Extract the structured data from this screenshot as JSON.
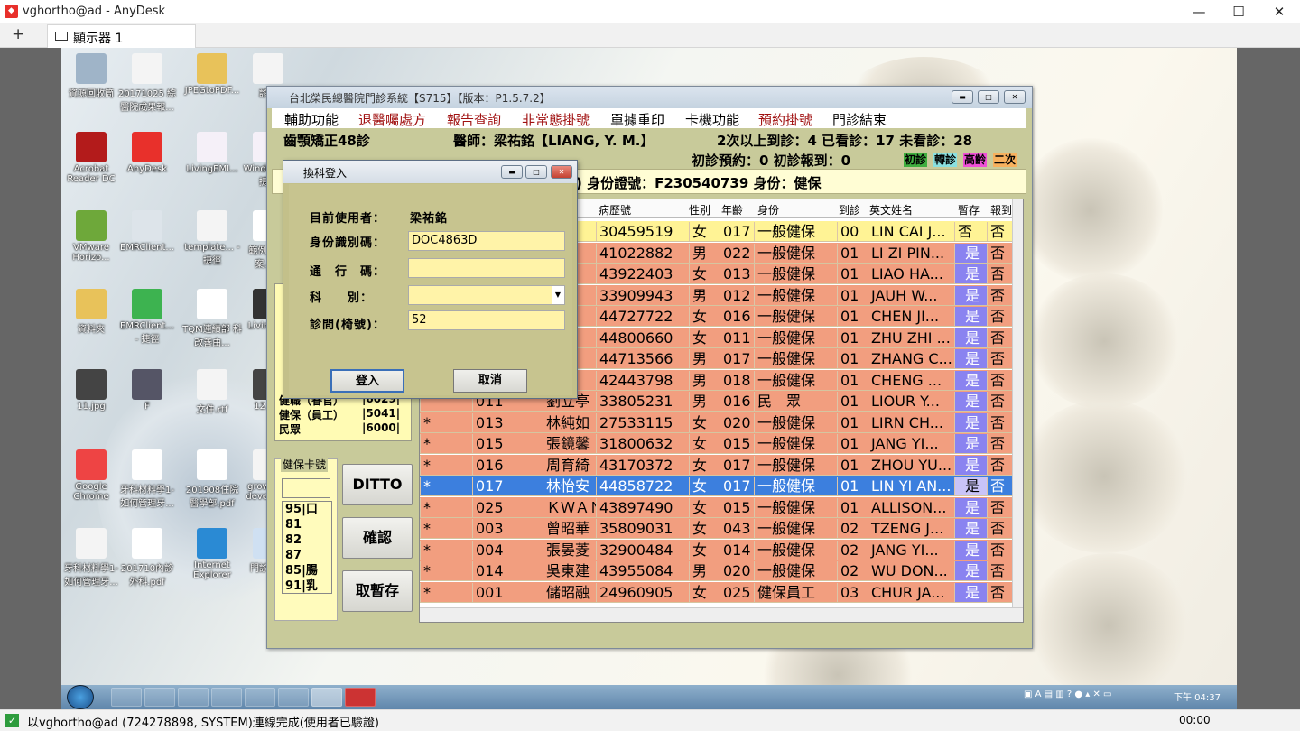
{
  "anydesk": {
    "window_title": "vghortho@ad - AnyDesk",
    "tab_label": "顯示器 1",
    "win_min": "—",
    "win_max": "☐",
    "win_close": "✕",
    "plus": "+",
    "status_text": "以vghortho@ad (724278898, SYSTEM)連線完成(使用者已驗證)",
    "status_time": "00:00"
  },
  "desktop": {
    "icons": [
      {
        "label": "資源回收筒",
        "icon": "recycle-bin-icon"
      },
      {
        "label": "20171025 綜醫院成果報...",
        "icon": "document-icon"
      },
      {
        "label": "JPEGtoPDF...",
        "icon": "folder-icon"
      },
      {
        "label": "診斷",
        "icon": "document-icon"
      },
      {
        "label": "Acrobat Reader DC",
        "icon": "acrobat-icon"
      },
      {
        "label": "AnyDesk",
        "icon": "anydesk-icon"
      },
      {
        "label": "LivingEMI...",
        "icon": "hospital-app-icon"
      },
      {
        "label": "Window... - 捷徑",
        "icon": "hospital-app-icon"
      },
      {
        "label": "VMware Horizo...",
        "icon": "vmware-icon"
      },
      {
        "label": "EMRClient...",
        "icon": "settings-file-icon"
      },
      {
        "label": "template... - 捷徑",
        "icon": "document-icon"
      },
      {
        "label": "範例 品質 案.pdf",
        "icon": "pdf-icon"
      },
      {
        "label": "資料夾",
        "icon": "folder-icon"
      },
      {
        "label": "EMRClient... - 捷徑",
        "icon": "medical-cross-icon"
      },
      {
        "label": "TQM連續部 科改善由...",
        "icon": "pdf-icon"
      },
      {
        "label": "LivingEM",
        "icon": "tooth-icon"
      },
      {
        "label": "11.jpg",
        "icon": "xray-icon"
      },
      {
        "label": "F",
        "icon": "image-app-icon"
      },
      {
        "label": "文件.rtf",
        "icon": "document-icon"
      },
      {
        "label": "12.jpg",
        "icon": "xray-icon"
      },
      {
        "label": "Google Chrome",
        "icon": "chrome-icon"
      },
      {
        "label": "牙科材料學1-如何管理牙...",
        "icon": "pdf-icon"
      },
      {
        "label": "201908住院 醫學部.pdf",
        "icon": "pdf-icon"
      },
      {
        "label": "growth & develop...",
        "icon": "document-icon"
      },
      {
        "label": "牙科材料學1-如何管理牙...",
        "icon": "document-icon"
      },
      {
        "label": "201710內診 外科.pdf",
        "icon": "pdf-icon"
      },
      {
        "label": "Internet Explorer",
        "icon": "ie-icon"
      },
      {
        "label": "門診系統",
        "icon": "window-app-icon"
      }
    ],
    "clock": "下午 04:37"
  },
  "app": {
    "title": "台北榮民總醫院門診系統【S715】【版本：P1.5.7.2】",
    "menu": [
      "輔助功能",
      "退醫囑處方",
      "報告查詢",
      "非常態掛號",
      "單據重印",
      "卡機功能",
      "預約掛號",
      "門診結束"
    ],
    "menu_colors": [
      "#000000",
      "#a01010",
      "#a01010",
      "#a01010",
      "#000000",
      "#000000",
      "#a01010",
      "#000000"
    ],
    "clinic": "齒顎矯正48診",
    "doctor": "醫師：梁祐銘【LIANG, Y. M.】",
    "counts": "2次以上到診：4  已看診：17  未看診：28",
    "reserve": "初診預約：0  初診報到：0",
    "legend": [
      "初診",
      "轉診",
      "高齡",
      "二次"
    ],
    "legend_colors": [
      "#3fae3f",
      "#8ae0e0",
      "#ee4fd6",
      "#f7b15e"
    ],
    "id_line": ")  身份證號：F230540739  身份：健保",
    "grid_headers": [
      "病歷號",
      "性別",
      "年齡",
      "身份",
      "到診",
      "英文姓名",
      "暫存",
      "報到"
    ],
    "rows": [
      {
        "mark": "",
        "no": "",
        "name": "",
        "chart": "30459519",
        "sex": "女",
        "age": "017",
        "id": "一般健保",
        "visit": "00",
        "en": "LIN CAI J...",
        "tmp": "否",
        "chk": "否",
        "style": "hl"
      },
      {
        "mark": "",
        "no": "",
        "name": "",
        "chart": "41022882",
        "sex": "男",
        "age": "022",
        "id": "一般健保",
        "visit": "01",
        "en": "LI ZI PIN...",
        "tmp": "是",
        "chk": "否",
        "style": ""
      },
      {
        "mark": "",
        "no": "",
        "name": "",
        "chart": "43922403",
        "sex": "女",
        "age": "013",
        "id": "一般健保",
        "visit": "01",
        "en": "LIAO HA...",
        "tmp": "是",
        "chk": "否",
        "style": ""
      },
      {
        "mark": "",
        "no": "",
        "name": "",
        "chart": "33909943",
        "sex": "男",
        "age": "012",
        "id": "一般健保",
        "visit": "01",
        "en": "JAUH W...",
        "tmp": "是",
        "chk": "否",
        "style": ""
      },
      {
        "mark": "",
        "no": "",
        "name": "",
        "chart": "44727722",
        "sex": "女",
        "age": "016",
        "id": "一般健保",
        "visit": "01",
        "en": "CHEN JI...",
        "tmp": "是",
        "chk": "否",
        "style": ""
      },
      {
        "mark": "",
        "no": "",
        "name": "",
        "chart": "44800660",
        "sex": "女",
        "age": "011",
        "id": "一般健保",
        "visit": "01",
        "en": "ZHU ZHI ...",
        "tmp": "是",
        "chk": "否",
        "style": ""
      },
      {
        "mark": "",
        "no": "",
        "name": "",
        "chart": "44713566",
        "sex": "男",
        "age": "017",
        "id": "一般健保",
        "visit": "01",
        "en": "ZHANG C...",
        "tmp": "是",
        "chk": "否",
        "style": ""
      },
      {
        "mark": "",
        "no": "",
        "name": "",
        "chart": "42443798",
        "sex": "男",
        "age": "018",
        "id": "一般健保",
        "visit": "01",
        "en": "CHENG ...",
        "tmp": "是",
        "chk": "否",
        "style": ""
      },
      {
        "mark": "",
        "no": "011",
        "name": "劉立亭",
        "chart": "33805231",
        "sex": "男",
        "age": "016",
        "id": "民　眾",
        "visit": "01",
        "en": "LIOUR Y...",
        "tmp": "是",
        "chk": "否",
        "style": ""
      },
      {
        "mark": "*",
        "no": "013",
        "name": "林純如",
        "chart": "27533115",
        "sex": "女",
        "age": "020",
        "id": "一般健保",
        "visit": "01",
        "en": "LIRN CH...",
        "tmp": "是",
        "chk": "否",
        "style": ""
      },
      {
        "mark": "*",
        "no": "015",
        "name": "張鏡馨",
        "chart": "31800632",
        "sex": "女",
        "age": "015",
        "id": "一般健保",
        "visit": "01",
        "en": "JANG YI...",
        "tmp": "是",
        "chk": "否",
        "style": ""
      },
      {
        "mark": "*",
        "no": "016",
        "name": "周育綺",
        "chart": "43170372",
        "sex": "女",
        "age": "017",
        "id": "一般健保",
        "visit": "01",
        "en": "ZHOU YU...",
        "tmp": "是",
        "chk": "否",
        "style": ""
      },
      {
        "mark": "*",
        "no": "017",
        "name": "林怡安",
        "chart": "44858722",
        "sex": "女",
        "age": "017",
        "id": "一般健保",
        "visit": "01",
        "en": "LIN YI AN...",
        "tmp": "是",
        "chk": "否",
        "style": "sel"
      },
      {
        "mark": "*",
        "no": "025",
        "name": "ＫＷＡＮ",
        "chart": "43897490",
        "sex": "女",
        "age": "015",
        "id": "一般健保",
        "visit": "01",
        "en": "ALLISON...",
        "tmp": "是",
        "chk": "否",
        "style": ""
      },
      {
        "mark": "*",
        "no": "003",
        "name": "曾昭華",
        "chart": "35809031",
        "sex": "女",
        "age": "043",
        "id": "一般健保",
        "visit": "02",
        "en": "TZENG J...",
        "tmp": "是",
        "chk": "否",
        "style": ""
      },
      {
        "mark": "*",
        "no": "004",
        "name": "張晏菱",
        "chart": "32900484",
        "sex": "女",
        "age": "014",
        "id": "一般健保",
        "visit": "02",
        "en": "JANG YI...",
        "tmp": "是",
        "chk": "否",
        "style": ""
      },
      {
        "mark": "*",
        "no": "014",
        "name": "吳東建",
        "chart": "43955084",
        "sex": "男",
        "age": "020",
        "id": "一般健保",
        "visit": "02",
        "en": "WU DON...",
        "tmp": "是",
        "chk": "否",
        "style": ""
      },
      {
        "mark": "*",
        "no": "001",
        "name": "儲昭融",
        "chart": "24960905",
        "sex": "女",
        "age": "025",
        "id": "健保員工",
        "visit": "03",
        "en": "CHUR JA...",
        "tmp": "是",
        "chk": "否",
        "style": ""
      }
    ],
    "id_list": [
      {
        "label": "健職（眷官）",
        "code": "|6029|"
      },
      {
        "label": "健保（員工）",
        "code": "|5041|"
      },
      {
        "label": "民眾",
        "code": "|6000|"
      }
    ],
    "card_title": "健保卡號",
    "card_items": [
      "95|口",
      "81",
      "82",
      "87",
      "85|腸",
      "91|乳"
    ],
    "btn_ditto": "DITTO",
    "btn_confirm": "確認",
    "btn_cancel_hold": "取暫存"
  },
  "dialog": {
    "title": "換科登入",
    "user_label": "目前使用者：",
    "user_value": "梁祐銘",
    "id_label": "身份識別碼：",
    "id_value": "DOC4863D",
    "pwd_label": "通　行　碼：",
    "pwd_value": "",
    "dept_label": "科　　別：",
    "dept_value": "",
    "room_label": "診間(椅號)：",
    "room_value": "52",
    "login": "登入",
    "cancel": "取消"
  }
}
